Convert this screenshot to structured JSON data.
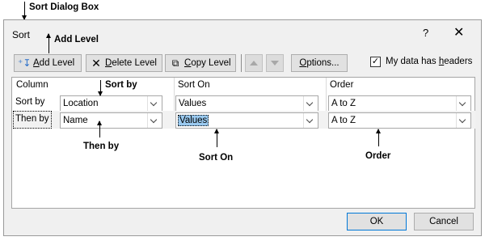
{
  "annotations": {
    "sort_dialog_box": "Sort Dialog Box",
    "add_level": "Add Level",
    "sort_by": "Sort by",
    "then_by": "Then by",
    "sort_on": "Sort On",
    "order": "Order"
  },
  "dialog": {
    "title": "Sort",
    "help": "?",
    "close": "✕"
  },
  "toolbar": {
    "add_level": "Add Level",
    "delete_level": "Delete Level",
    "copy_level": "Copy Level",
    "options": "Options...",
    "headers_label": "My data has headers",
    "headers_checked": true
  },
  "grid": {
    "headers": {
      "column": "Column",
      "sort_on": "Sort On",
      "order": "Order"
    },
    "rows": [
      {
        "label": "Sort by",
        "column": "Location",
        "sort_on": "Values",
        "order": "A to Z"
      },
      {
        "label": "Then by",
        "column": "Name",
        "sort_on": "Values",
        "order": "A to Z"
      }
    ]
  },
  "buttons": {
    "ok": "OK",
    "cancel": "Cancel"
  }
}
